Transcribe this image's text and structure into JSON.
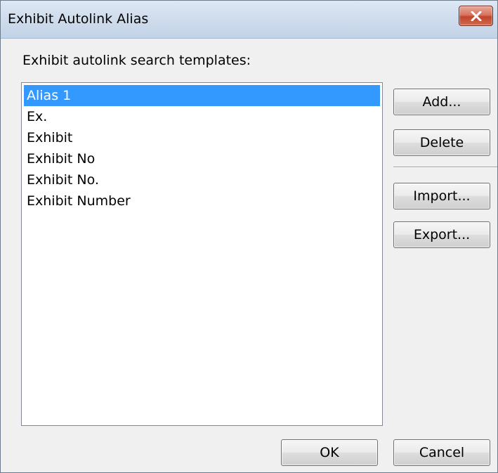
{
  "window": {
    "title": "Exhibit Autolink Alias",
    "close_icon": "close-x-icon"
  },
  "prompt": "Exhibit autolink search templates:",
  "list": {
    "items": [
      {
        "label": "Alias 1",
        "selected": true
      },
      {
        "label": "Ex.",
        "selected": false
      },
      {
        "label": "Exhibit",
        "selected": false
      },
      {
        "label": "Exhibit No",
        "selected": false
      },
      {
        "label": "Exhibit No.",
        "selected": false
      },
      {
        "label": "Exhibit Number",
        "selected": false
      }
    ]
  },
  "buttons": {
    "add": "Add...",
    "delete": "Delete",
    "import": "Import...",
    "export": "Export...",
    "ok": "OK",
    "cancel": "Cancel"
  },
  "colors": {
    "selection": "#3399ff",
    "close_button": "#c2442c"
  }
}
